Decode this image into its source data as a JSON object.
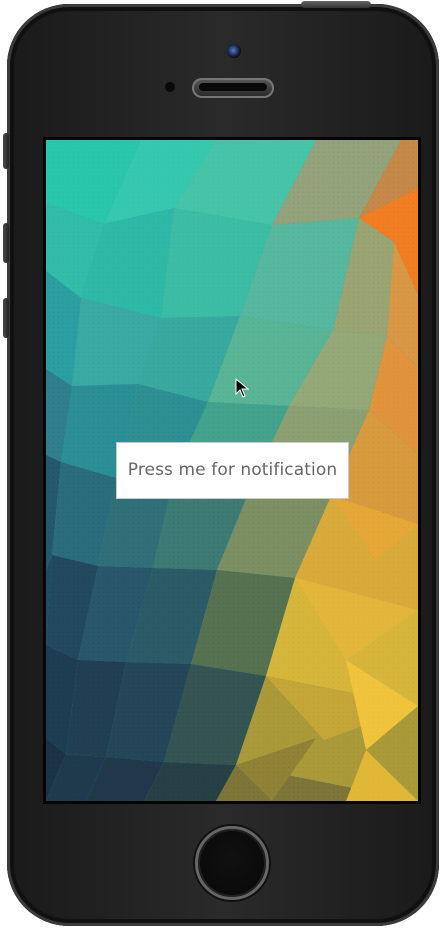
{
  "device": {
    "model": "iPhone",
    "accent_colors": {
      "frame": "#1f1f1f",
      "screen_border": "#050505",
      "camera_lens": "#5a7cc9"
    },
    "icons": {
      "camera": "front-camera-icon",
      "speaker": "earpiece-speaker-icon",
      "home": "home-button",
      "cursor": "mouse-cursor-icon"
    }
  },
  "screen": {
    "background_style": "low-poly gradient",
    "button": {
      "label": "Press me for notification"
    }
  }
}
